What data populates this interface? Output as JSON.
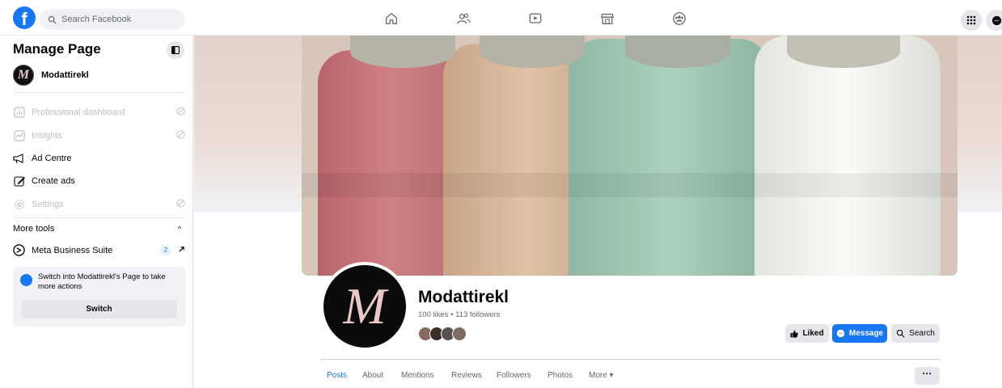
{
  "topbar": {
    "logo": "f",
    "search_placeholder": "Search Facebook",
    "nav_icons": [
      "home-icon",
      "friends-icon",
      "watch-icon",
      "marketplace-icon",
      "groups-icon"
    ]
  },
  "sidebar": {
    "title": "Manage Page",
    "page_name": "Modattirekl",
    "page_avatar_letter": "M",
    "menu": [
      {
        "label": "Professional dashboard",
        "icon": "dashboard-icon",
        "disabled": true
      },
      {
        "label": "Insights",
        "icon": "insights-icon",
        "disabled": true
      },
      {
        "label": "Ad Centre",
        "icon": "megaphone-icon",
        "disabled": false
      },
      {
        "label": "Create ads",
        "icon": "pencil-icon",
        "disabled": false
      },
      {
        "label": "Settings",
        "icon": "gear-icon",
        "disabled": true
      }
    ],
    "more_tools_label": "More tools",
    "meta_business_suite": {
      "label": "Meta Business Suite",
      "badge": "2"
    },
    "switch_prompt": "Switch into Modattirekl's Page to take more actions",
    "switch_button": "Switch"
  },
  "profile": {
    "name": "Modattirekl",
    "avatar_letter": "M",
    "stats": "100 likes • 113 followers",
    "buttons": {
      "liked": "Liked",
      "message": "Message",
      "search": "Search"
    },
    "tabs": [
      "Posts",
      "About",
      "Mentions",
      "Reviews",
      "Followers",
      "Photos",
      "More ▾"
    ],
    "active_tab": "Posts",
    "more_button": "···"
  },
  "colors": {
    "accent": "#1877f2",
    "cover_dress_1": "#c97c80",
    "cover_dress_2": "#d8b79c",
    "cover_dress_3": "#9ec4b0",
    "cover_dress_4": "#f3f3f1"
  }
}
